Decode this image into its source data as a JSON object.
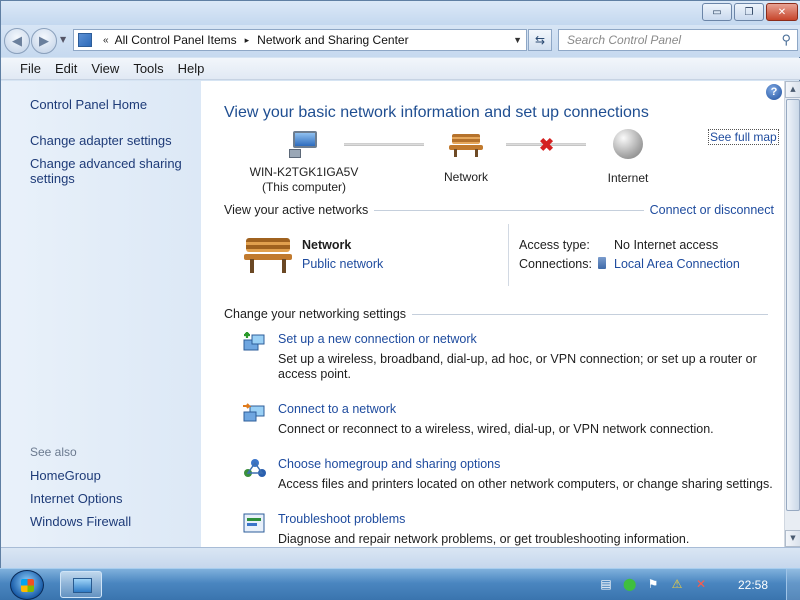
{
  "window": {
    "controls": {
      "minimize": "▭",
      "maximize": "❐",
      "close": "✕"
    }
  },
  "address": {
    "prefix": "«",
    "crumbs": [
      "All Control Panel Items",
      "Network and Sharing Center"
    ],
    "separator": "▸",
    "dropdown": "▼"
  },
  "search": {
    "placeholder": "Search Control Panel"
  },
  "menubar": {
    "items": [
      "File",
      "Edit",
      "View",
      "Tools",
      "Help"
    ]
  },
  "sidebar": {
    "home": "Control Panel Home",
    "links": [
      "Change adapter settings",
      "Change advanced sharing settings"
    ],
    "see_also_header": "See also",
    "see_also": [
      "HomeGroup",
      "Internet Options",
      "Windows Firewall"
    ]
  },
  "main": {
    "headline": "View your basic network information and set up connections",
    "see_full_map": "See full map",
    "map": {
      "computer_name": "WIN-K2TGK1IGA5V",
      "computer_sub": "(This computer)",
      "network_label": "Network",
      "internet_label": "Internet"
    },
    "active_networks": {
      "header": "View your active networks",
      "connect_link": "Connect or disconnect",
      "name": "Network",
      "type": "Public network",
      "access_type_key": "Access type:",
      "access_type_val": "No Internet access",
      "connections_key": "Connections:",
      "connections_val": "Local Area Connection"
    },
    "settings": {
      "header": "Change your networking settings",
      "tasks": [
        {
          "link": "Set up a new connection or network",
          "desc": "Set up a wireless, broadband, dial-up, ad hoc, or VPN connection; or set up a router or access point."
        },
        {
          "link": "Connect to a network",
          "desc": "Connect or reconnect to a wireless, wired, dial-up, or VPN network connection."
        },
        {
          "link": "Choose homegroup and sharing options",
          "desc": "Access files and printers located on other network computers, or change sharing settings."
        },
        {
          "link": "Troubleshoot problems",
          "desc": "Diagnose and repair network problems, or get troubleshooting information."
        }
      ]
    }
  },
  "taskbar": {
    "clock": "22:58"
  },
  "colors": {
    "link": "#1e4b9e",
    "headline": "#1f4e91",
    "error": "#d42020"
  }
}
